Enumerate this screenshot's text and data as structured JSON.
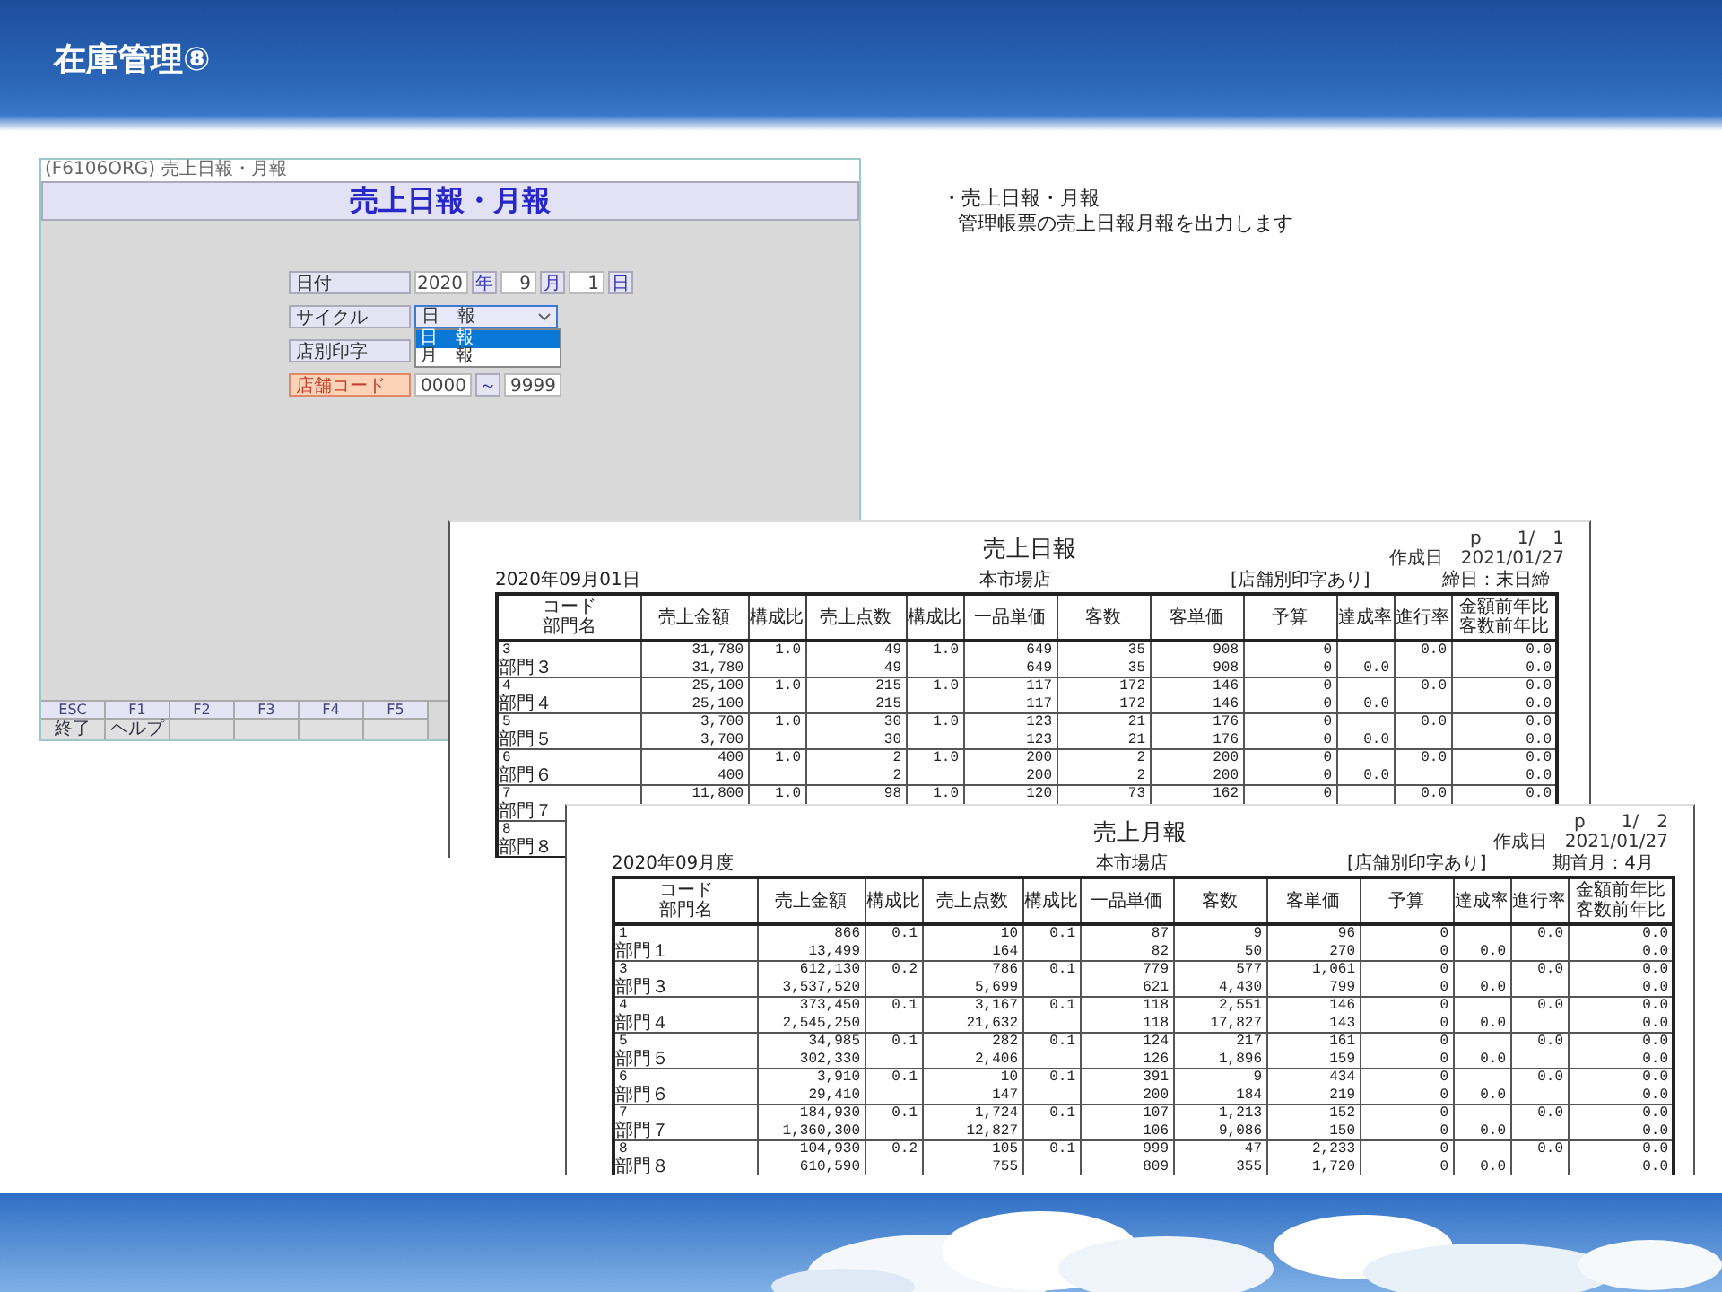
{
  "slide": {
    "title": "在庫管理⑧"
  },
  "app": {
    "title": "(F6106ORG) 売上日報・月報",
    "heading": "売上日報・月報",
    "date": {
      "label": "日付",
      "year": "2020",
      "year_unit": "年",
      "month": "9",
      "month_unit": "月",
      "day": "1",
      "day_unit": "日"
    },
    "cycle": {
      "label": "サイクル",
      "value": "日　報",
      "expanded": true,
      "options": [
        {
          "label": "日　報",
          "selected": true
        },
        {
          "label": "月　報",
          "selected": false
        }
      ]
    },
    "store_print": {
      "label": "店別印字"
    },
    "store_code": {
      "label": "店舗コード",
      "from": "0000",
      "separator": "～",
      "to": "9999"
    },
    "fkeys": [
      {
        "key": "ESC",
        "label": "終了"
      },
      {
        "key": "F1",
        "label": "ヘルプ"
      },
      {
        "key": "F2"
      },
      {
        "key": "F3"
      },
      {
        "key": "F4"
      },
      {
        "key": "F5"
      }
    ]
  },
  "notes": [
    "・売上日報・月報",
    "管理帳票の売上日報月報を出力します"
  ],
  "reports": [
    {
      "title": "売上日報",
      "page": "p　　1/　1",
      "created": "作成日　2021/01/27",
      "period": "2020年09月01日",
      "store": "本市場店",
      "print_mode": "[店舗別印字あり]",
      "closing": "締日：末日締",
      "columns": [
        {
          "label": "コード",
          "sub": "部門名"
        },
        {
          "label": "売上金額"
        },
        {
          "label": "構成比"
        },
        {
          "label": "売上点数"
        },
        {
          "label": "構成比"
        },
        {
          "label": "一品単価"
        },
        {
          "label": "客数"
        },
        {
          "label": "客単価"
        },
        {
          "label": "予算"
        },
        {
          "label": "達成率"
        },
        {
          "label": "進行率"
        },
        {
          "label": "金額前年比",
          "sub": "客数前年比"
        }
      ],
      "rows": [
        {
          "code": "3",
          "name": "部門３",
          "l1": [
            "31,780",
            "1.0",
            "49",
            "1.0",
            "649",
            "35",
            "908",
            "0",
            "0.0",
            "0.0"
          ],
          "l2": [
            "31,780",
            "49",
            "649",
            "35",
            "908",
            "0",
            "0.0",
            "0.0"
          ]
        },
        {
          "code": "4",
          "name": "部門４",
          "l1": [
            "25,100",
            "1.0",
            "215",
            "1.0",
            "117",
            "172",
            "146",
            "0",
            "0.0",
            "0.0"
          ],
          "l2": [
            "25,100",
            "215",
            "117",
            "172",
            "146",
            "0",
            "0.0",
            "0.0"
          ]
        },
        {
          "code": "5",
          "name": "部門５",
          "l1": [
            "3,700",
            "1.0",
            "30",
            "1.0",
            "123",
            "21",
            "176",
            "0",
            "0.0",
            "0.0"
          ],
          "l2": [
            "3,700",
            "30",
            "123",
            "21",
            "176",
            "0",
            "0.0",
            "0.0"
          ]
        },
        {
          "code": "6",
          "name": "部門６",
          "l1": [
            "400",
            "1.0",
            "2",
            "1.0",
            "200",
            "2",
            "200",
            "0",
            "0.0",
            "0.0"
          ],
          "l2": [
            "400",
            "2",
            "200",
            "2",
            "200",
            "0",
            "0.0",
            "0.0"
          ]
        },
        {
          "code": "7",
          "name": "部門７",
          "l1": [
            "11,800",
            "1.0",
            "98",
            "1.0",
            "120",
            "73",
            "162",
            "0",
            "0.0",
            "0.0"
          ]
        },
        {
          "code": "8",
          "name": "部門８"
        }
      ]
    },
    {
      "title": "売上月報",
      "page": "p　　1/　2",
      "created": "作成日　2021/01/27",
      "period": "2020年09月度",
      "store": "本市場店",
      "print_mode": "[店舗別印字あり]",
      "closing": "期首月：4月",
      "columns": [
        {
          "label": "コード",
          "sub": "部門名"
        },
        {
          "label": "売上金額"
        },
        {
          "label": "構成比"
        },
        {
          "label": "売上点数"
        },
        {
          "label": "構成比"
        },
        {
          "label": "一品単価"
        },
        {
          "label": "客数"
        },
        {
          "label": "客単価"
        },
        {
          "label": "予算"
        },
        {
          "label": "達成率"
        },
        {
          "label": "進行率"
        },
        {
          "label": "金額前年比",
          "sub": "客数前年比"
        }
      ],
      "rows": [
        {
          "code": "1",
          "name": "部門１",
          "l1": [
            "866",
            "0.1",
            "10",
            "0.1",
            "87",
            "9",
            "96",
            "0",
            "0.0",
            "0.0"
          ],
          "l2": [
            "13,499",
            "164",
            "82",
            "50",
            "270",
            "0",
            "0.0",
            "0.0"
          ]
        },
        {
          "code": "3",
          "name": "部門３",
          "l1": [
            "612,130",
            "0.2",
            "786",
            "0.1",
            "779",
            "577",
            "1,061",
            "0",
            "0.0",
            "0.0"
          ],
          "l2": [
            "3,537,520",
            "5,699",
            "621",
            "4,430",
            "799",
            "0",
            "0.0",
            "0.0"
          ]
        },
        {
          "code": "4",
          "name": "部門４",
          "l1": [
            "373,450",
            "0.1",
            "3,167",
            "0.1",
            "118",
            "2,551",
            "146",
            "0",
            "0.0",
            "0.0"
          ],
          "l2": [
            "2,545,250",
            "21,632",
            "118",
            "17,827",
            "143",
            "0",
            "0.0",
            "0.0"
          ]
        },
        {
          "code": "5",
          "name": "部門５",
          "l1": [
            "34,985",
            "0.1",
            "282",
            "0.1",
            "124",
            "217",
            "161",
            "0",
            "0.0",
            "0.0"
          ],
          "l2": [
            "302,330",
            "2,406",
            "126",
            "1,896",
            "159",
            "0",
            "0.0",
            "0.0"
          ]
        },
        {
          "code": "6",
          "name": "部門６",
          "l1": [
            "3,910",
            "0.1",
            "10",
            "0.1",
            "391",
            "9",
            "434",
            "0",
            "0.0",
            "0.0"
          ],
          "l2": [
            "29,410",
            "147",
            "200",
            "184",
            "219",
            "0",
            "0.0",
            "0.0"
          ]
        },
        {
          "code": "7",
          "name": "部門７",
          "l1": [
            "184,930",
            "0.1",
            "1,724",
            "0.1",
            "107",
            "1,213",
            "152",
            "0",
            "0.0",
            "0.0"
          ],
          "l2": [
            "1,360,300",
            "12,827",
            "106",
            "9,086",
            "150",
            "0",
            "0.0",
            "0.0"
          ]
        },
        {
          "code": "8",
          "name": "部門８",
          "l1": [
            "104,930",
            "0.2",
            "105",
            "0.1",
            "999",
            "47",
            "2,233",
            "0",
            "0.0",
            "0.0"
          ],
          "l2": [
            "610,590",
            "755",
            "809",
            "355",
            "1,720",
            "0",
            "0.0",
            "0.0"
          ]
        }
      ]
    }
  ]
}
